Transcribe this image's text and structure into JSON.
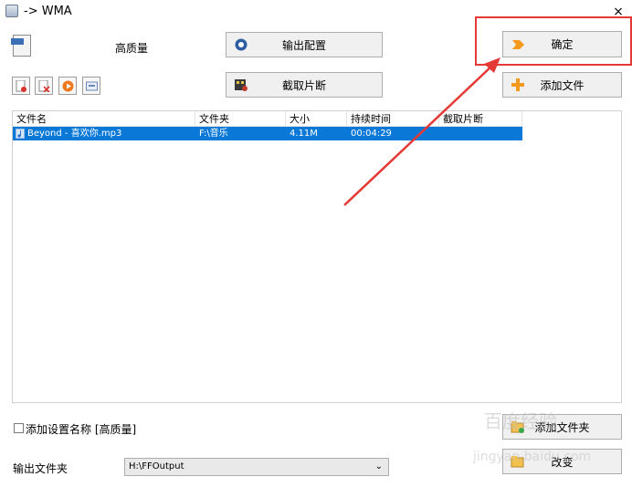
{
  "window": {
    "title": "-> WMA",
    "close_glyph": "×"
  },
  "preset": {
    "label": "高质量",
    "icon": "wma-file-icon"
  },
  "buttons": {
    "output_config": "输出配置",
    "clip_segment": "截取片断",
    "confirm": "确定",
    "add_file": "添加文件",
    "add_folder": "添加文件夹",
    "change": "改变"
  },
  "toolbar": [
    {
      "name": "remove-file-icon"
    },
    {
      "name": "clear-list-icon"
    },
    {
      "name": "play-icon"
    },
    {
      "name": "media-info-icon"
    }
  ],
  "table": {
    "columns": [
      "文件名",
      "文件夹",
      "大小",
      "持续时间",
      "截取片断"
    ],
    "rows": [
      {
        "filename": "Beyond - 喜欢你.mp3",
        "folder": "F:\\音乐",
        "size": "4.11M",
        "duration": "00:04:29",
        "clip": ""
      }
    ]
  },
  "add_preset_name": {
    "label": "添加设置名称 [高质量]",
    "checked": false
  },
  "output_folder": {
    "label": "输出文件夹",
    "value": "H:\\FFOutput"
  },
  "colors": {
    "selection": "#0a78d7",
    "highlight": "#e53935",
    "accent_orange": "#f39a1e"
  },
  "watermark": {
    "line1": "百度经验",
    "line2": "jingyan.baidu.com"
  }
}
